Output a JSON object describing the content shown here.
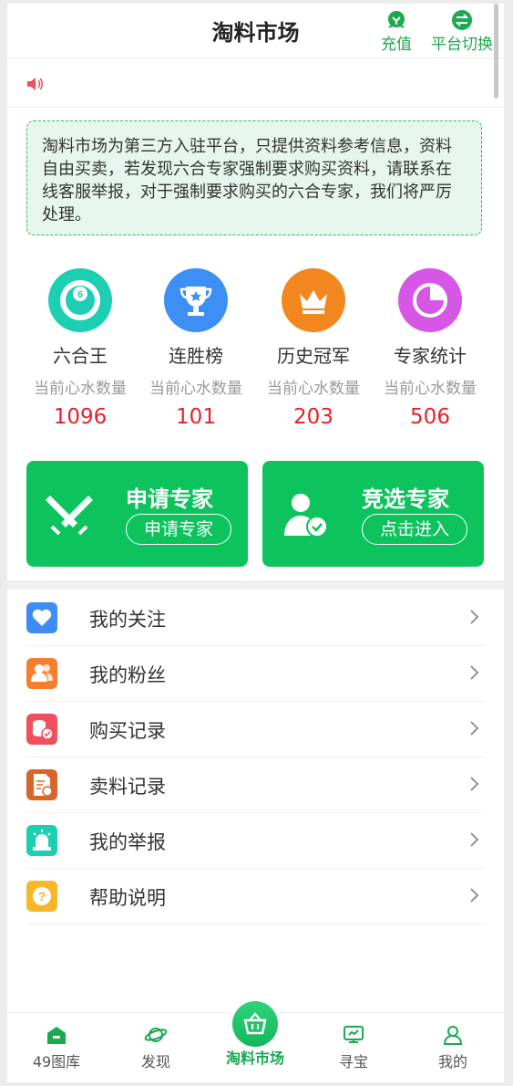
{
  "header": {
    "title": "淘料市场",
    "recharge_label": "充值",
    "switch_label": "平台切换"
  },
  "disclaimer": "淘料市场为第三方入驻平台，只提供资料参考信息，资料自由买卖，若发现六合专家强制要求购买资料，请联系在线客服举报，对于强制要求购买的六合专家，我们将严厉处理。",
  "stats": [
    {
      "name": "六合王",
      "sub": "当前心水数量",
      "value": "1096",
      "icon": "ball-6-icon",
      "color": "#1ccfb2"
    },
    {
      "name": "连胜榜",
      "sub": "当前心水数量",
      "value": "101",
      "icon": "trophy-icon",
      "color": "#3d8ef5"
    },
    {
      "name": "历史冠军",
      "sub": "当前心水数量",
      "value": "203",
      "icon": "crown-icon",
      "color": "#f2871f"
    },
    {
      "name": "专家统计",
      "sub": "当前心水数量",
      "value": "506",
      "icon": "pie-chart-icon",
      "color": "#d657e6"
    }
  ],
  "cards": [
    {
      "title": "申请专家",
      "button": "申请专家",
      "icon": "crossed-swords-icon"
    },
    {
      "title": "竞选专家",
      "button": "点击进入",
      "icon": "user-check-icon"
    }
  ],
  "menu": [
    {
      "label": "我的关注",
      "icon": "heart-icon",
      "color": "#3e8cf5"
    },
    {
      "label": "我的粉丝",
      "icon": "users-icon",
      "color": "#f57f2e"
    },
    {
      "label": "购买记录",
      "icon": "coins-check-icon",
      "color": "#f0505b"
    },
    {
      "label": "卖料记录",
      "icon": "document-coin-icon",
      "color": "#d9652b"
    },
    {
      "label": "我的举报",
      "icon": "alarm-icon",
      "color": "#1ccfb2"
    },
    {
      "label": "帮助说明",
      "icon": "question-icon",
      "color": "#f7b72b"
    }
  ],
  "tabs": [
    {
      "label": "49图库",
      "icon": "house-icon"
    },
    {
      "label": "发现",
      "icon": "planet-icon"
    },
    {
      "label": "淘料市场",
      "icon": "basket-icon"
    },
    {
      "label": "寻宝",
      "icon": "monitor-icon"
    },
    {
      "label": "我的",
      "icon": "person-icon"
    }
  ],
  "colors": {
    "brand_green": "#0cc35d",
    "value_red": "#e8202a"
  }
}
